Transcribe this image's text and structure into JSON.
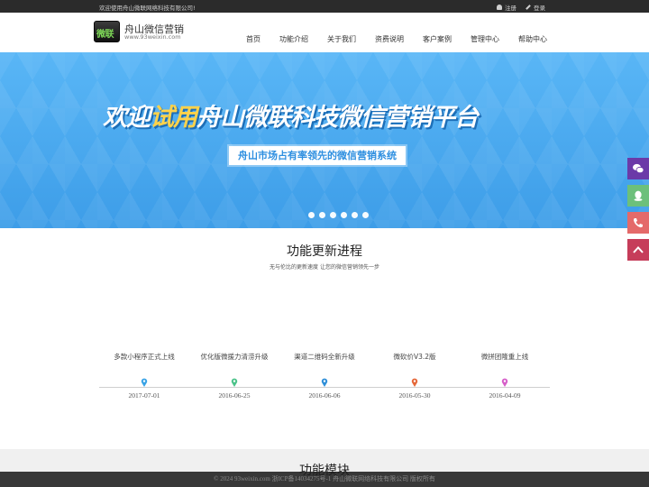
{
  "topbar": {
    "welcome": "欢迎使用舟山微联网络科技有限公司!",
    "register": "注册",
    "login": "登录"
  },
  "header": {
    "logo_badge": "微联",
    "logo_title": "舟山微信营销",
    "logo_url": "www.93weixin.com"
  },
  "nav": [
    {
      "label": "首页"
    },
    {
      "label": "功能介绍"
    },
    {
      "label": "关于我们"
    },
    {
      "label": "资费说明"
    },
    {
      "label": "客户案例"
    },
    {
      "label": "管理中心"
    },
    {
      "label": "帮助中心"
    }
  ],
  "banner": {
    "title_pre": "欢迎",
    "title_hl": "试用",
    "title_post": "舟山微联科技微信营销平台",
    "subtitle": "舟山市场占有率领先的微信营销系统",
    "slide_count": 6
  },
  "side_buttons": [
    "wechat-icon",
    "qq-icon",
    "phone-icon",
    "back-to-top-icon"
  ],
  "updates": {
    "title": "功能更新进程",
    "subtitle": "无与伦比的更新速度 让您的微信营销领先一步",
    "events": [
      {
        "label": "多款小程序正式上线",
        "date": "2017-07-01",
        "color": "#39a3e6"
      },
      {
        "label": "优化版微援力清涝升级",
        "date": "2016-06-25",
        "color": "#4cc38a"
      },
      {
        "label": "渠道二维码全新升级",
        "date": "2016-06-06",
        "color": "#2f8fd8"
      },
      {
        "label": "微砍价V3.2版",
        "date": "2016-05-30",
        "color": "#e5683a"
      },
      {
        "label": "微拼团隆重上线",
        "date": "2016-04-09",
        "color": "#d65fc9"
      }
    ]
  },
  "modules": {
    "title": "功能模块"
  },
  "footer": {
    "text": "© 2024 93weixin.com 浙ICP备14034275号-1 舟山微联网络科技有限公司 版权所有"
  }
}
